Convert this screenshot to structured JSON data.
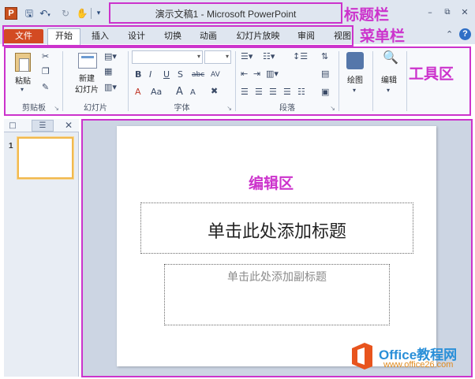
{
  "title_bar": {
    "app_icon_letter": "P",
    "title": "演示文稿1 - Microsoft PowerPoint"
  },
  "annotations": {
    "title_bar": "标题栏",
    "menu_bar": "菜单栏",
    "toolbar": "工具区",
    "edit_area": "编辑区"
  },
  "tabs": [
    {
      "label": "文件"
    },
    {
      "label": "开始"
    },
    {
      "label": "插入"
    },
    {
      "label": "设计"
    },
    {
      "label": "切换"
    },
    {
      "label": "动画"
    },
    {
      "label": "幻灯片放映"
    },
    {
      "label": "审阅"
    },
    {
      "label": "视图"
    }
  ],
  "ribbon": {
    "clipboard": {
      "group_label": "剪贴板",
      "paste_label": "粘贴"
    },
    "slides": {
      "group_label": "幻灯片",
      "new_slide_line1": "新建",
      "new_slide_line2": "幻灯片"
    },
    "font": {
      "group_label": "字体",
      "bold": "B",
      "italic": "I",
      "underline": "U",
      "shadow": "S",
      "strike": "abc",
      "spacing": "AV",
      "font_color": "A",
      "case": "Aa",
      "grow": "A",
      "shrink": "A"
    },
    "paragraph": {
      "group_label": "段落"
    },
    "drawing": {
      "label": "绘图"
    },
    "editing": {
      "label": "编辑"
    }
  },
  "slide_panel": {
    "slide_number": "1"
  },
  "slide": {
    "title_placeholder": "单击此处添加标题",
    "subtitle_placeholder": "单击此处添加副标题"
  },
  "watermark": {
    "brand": "Office教程网",
    "url": "www.office26.com"
  }
}
